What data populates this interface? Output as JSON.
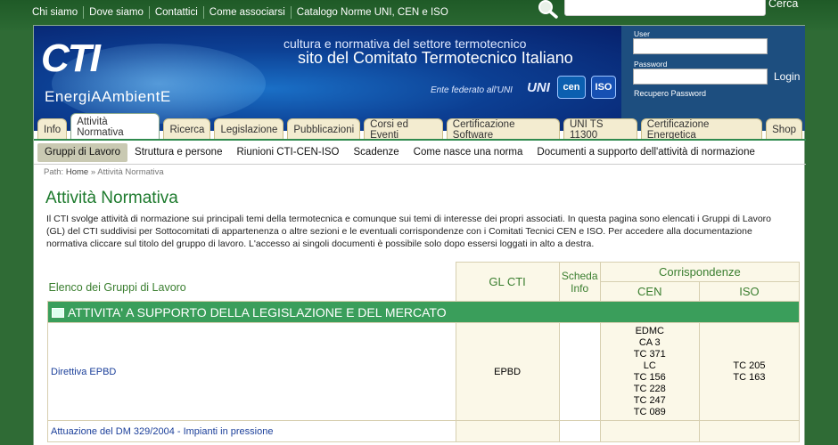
{
  "top_nav": {
    "links": [
      "Chi siamo",
      "Dove siamo",
      "Contattici",
      "Come associarsi",
      "Catalogo Norme UNI, CEN e ISO"
    ],
    "search_placeholder": "",
    "search_button": "Cerca"
  },
  "header": {
    "logo_text": "CTI",
    "logo_tagline": "EnergiAAmbientE",
    "tagline_1": "cultura e normativa del settore termotecnico",
    "tagline_2": "sito del Comitato Termotecnico Italiano",
    "federato": "Ente federato all'UNI",
    "partner_logos": [
      "UNI",
      "cen",
      "ISO"
    ]
  },
  "login": {
    "user_label": "User",
    "password_label": "Password",
    "login_button": "Login",
    "recover_link": "Recupero Password"
  },
  "tabs": [
    {
      "label": "Info",
      "active": false
    },
    {
      "label": "Attività Normativa",
      "active": true
    },
    {
      "label": "Ricerca",
      "active": false
    },
    {
      "label": "Legislazione",
      "active": false
    },
    {
      "label": "Pubblicazioni",
      "active": false
    },
    {
      "label": "Corsi ed Eventi",
      "active": false
    },
    {
      "label": "Certificazione Software",
      "active": false
    },
    {
      "label": "UNI TS 11300",
      "active": false
    },
    {
      "label": "Certificazione Energetica",
      "active": false
    },
    {
      "label": "Shop",
      "active": false
    }
  ],
  "subnav": [
    {
      "label": "Gruppi di Lavoro",
      "active": true
    },
    {
      "label": "Struttura e persone",
      "active": false
    },
    {
      "label": "Riunioni CTI-CEN-ISO",
      "active": false
    },
    {
      "label": "Scadenze",
      "active": false
    },
    {
      "label": "Come nasce una norma",
      "active": false
    },
    {
      "label": "Documenti a supporto dell'attività di normazione",
      "active": false
    }
  ],
  "breadcrumb": {
    "prefix": "Path:",
    "home": "Home",
    "sep": "»",
    "current": "Attività Normativa"
  },
  "page_title": "Attività Normativa",
  "intro": "Il CTI svolge attività di normazione sui principali temi della termotecnica e comunque sui temi di interesse dei propri associati. In questa pagina sono elencati i Gruppi di Lavoro (GL) del CTI suddivisi per Sottocomitati di appartenenza o altre sezioni e le eventuali corrispondenze con i Comitati Tecnici CEN e ISO. Per accedere alla documentazione normativa cliccare sul titolo del gruppo di lavoro. L'accesso ai singoli documenti è possibile solo dopo essersi loggati in alto a destra.",
  "table": {
    "elenco_label": "Elenco dei Gruppi di Lavoro",
    "col_gl": "GL CTI",
    "col_scheda": "Scheda Info",
    "col_corr": "Corrispondenze",
    "col_cen": "CEN",
    "col_iso": "ISO",
    "section_title": "ATTIVITA' A SUPPORTO DELLA LEGISLAZIONE E DEL MERCATO",
    "rows": [
      {
        "name": "Direttiva EPBD",
        "gl": "EPBD",
        "scheda": "",
        "cen": [
          "EDMC",
          "CA 3",
          "TC 371",
          "LC",
          "TC 156",
          "TC 228",
          "TC 247",
          "TC 089"
        ],
        "iso": [
          "TC 205",
          "TC 163"
        ]
      },
      {
        "name": "Attuazione del DM 329/2004 - Impianti in pressione",
        "gl": "",
        "scheda": "",
        "cen": [],
        "iso": []
      }
    ]
  },
  "colors": {
    "topbar": "#2c6a33",
    "accent_green": "#3a9e5b",
    "title_green": "#1d7a2d",
    "banner_blue": "#0c3f93",
    "tab_bg": "#f3ecd0"
  },
  "icons": [
    "search-icon",
    "section-icon"
  ]
}
